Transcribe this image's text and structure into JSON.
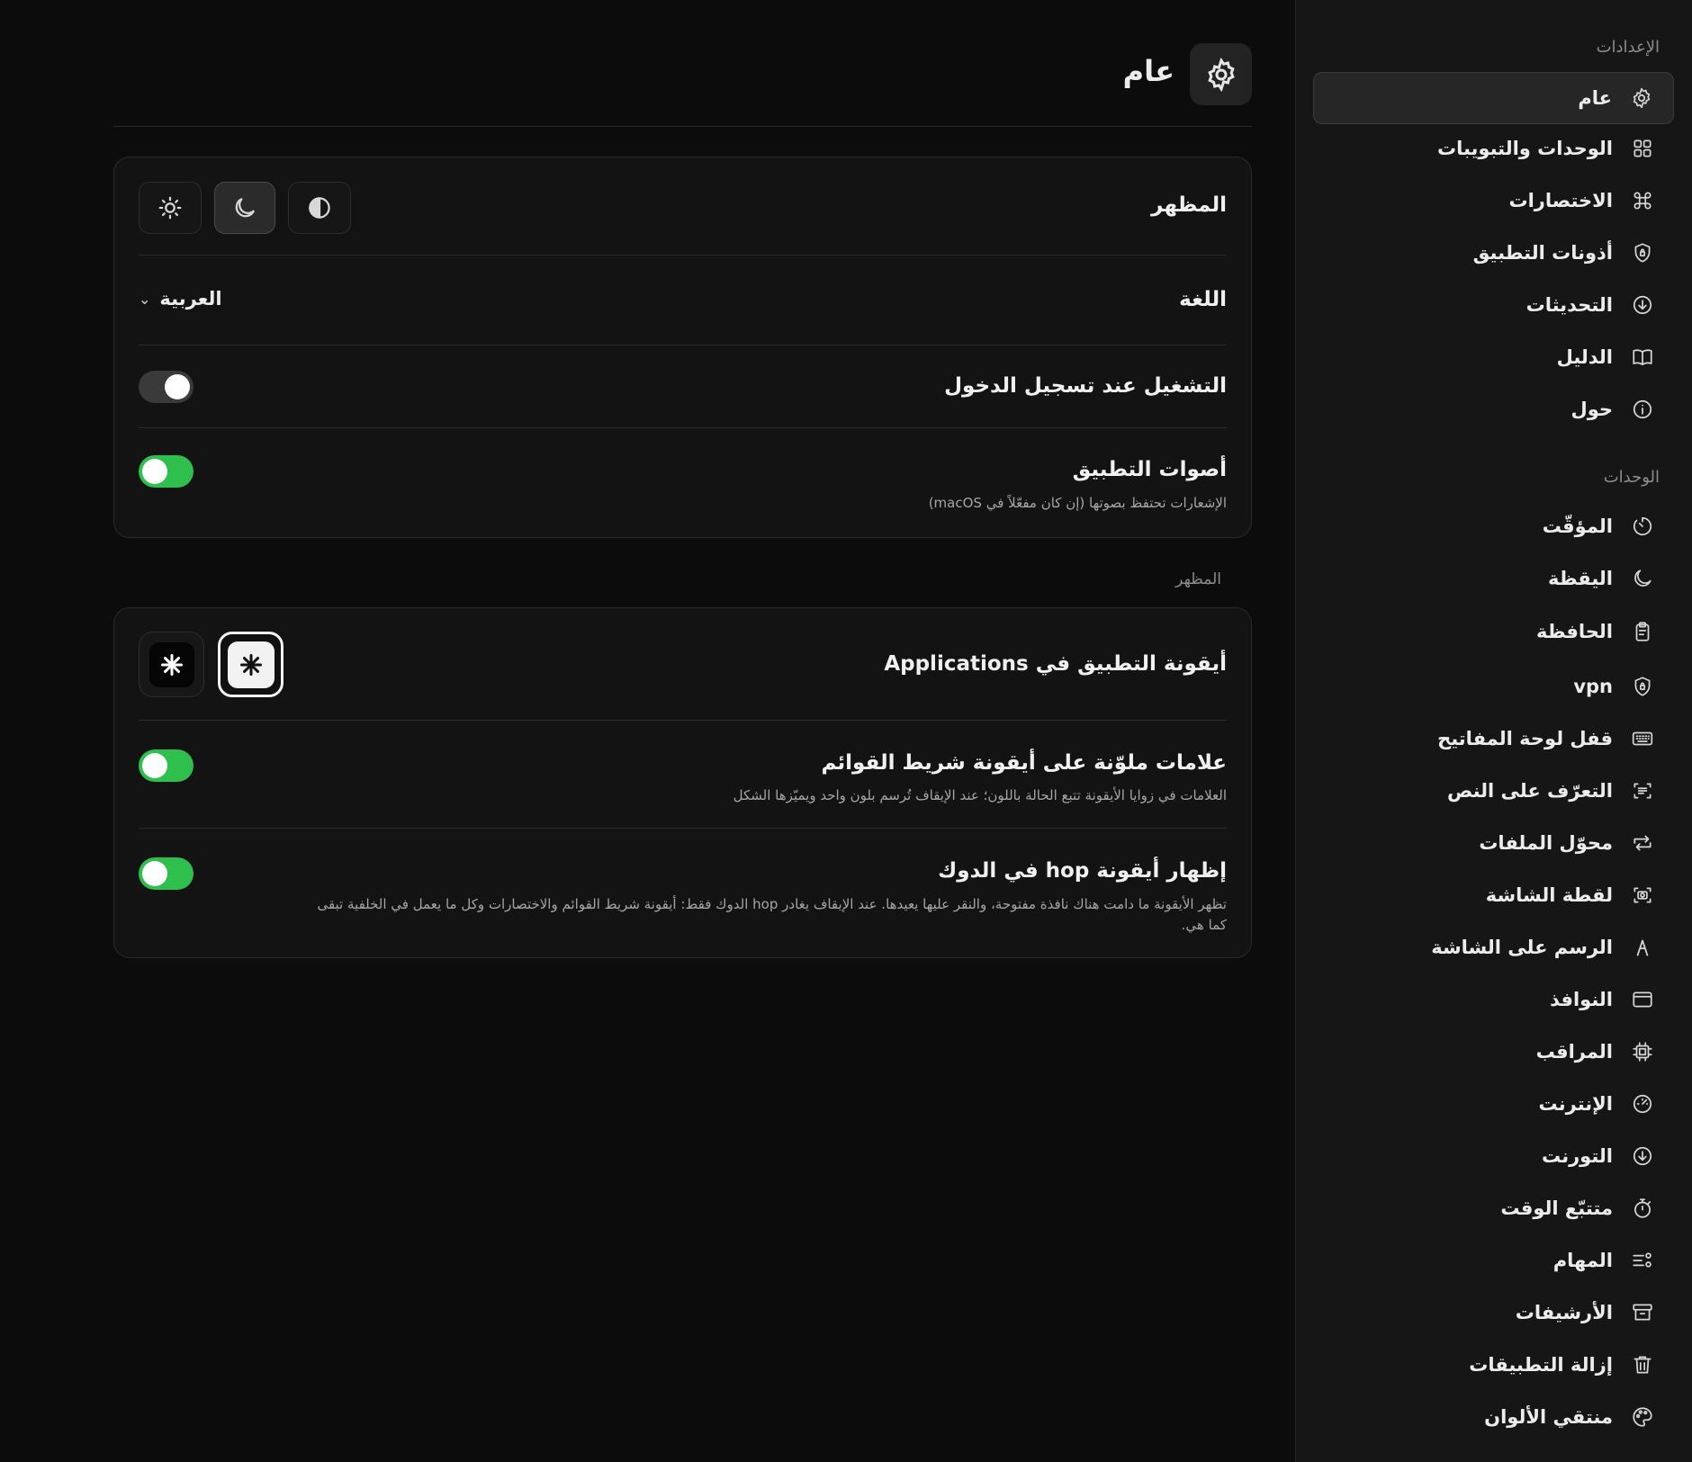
{
  "sidebar": {
    "settings_header": "الإعدادات",
    "settings_items": [
      {
        "label": "عام",
        "icon": "gear-icon",
        "active": true
      },
      {
        "label": "الوحدات والتبويبات",
        "icon": "grid-icon"
      },
      {
        "label": "الاختصارات",
        "icon": "command-icon"
      },
      {
        "label": "أذونات التطبيق",
        "icon": "shield-icon"
      },
      {
        "label": "التحديثات",
        "icon": "download-circle-icon"
      },
      {
        "label": "الدليل",
        "icon": "book-icon"
      },
      {
        "label": "حول",
        "icon": "info-icon"
      }
    ],
    "modules_header": "الوحدات",
    "module_items": [
      {
        "label": "المؤقّت",
        "icon": "timer-icon"
      },
      {
        "label": "اليقظة",
        "icon": "moon-icon"
      },
      {
        "label": "الحافظة",
        "icon": "clipboard-icon"
      },
      {
        "label": "vpn",
        "icon": "shield-lock-icon"
      },
      {
        "label": "قفل لوحة المفاتيح",
        "icon": "keyboard-icon"
      },
      {
        "label": "التعرّف على النص",
        "icon": "text-scan-icon"
      },
      {
        "label": "محوّل الملفات",
        "icon": "convert-icon"
      },
      {
        "label": "لقطة الشاشة",
        "icon": "screenshot-icon"
      },
      {
        "label": "الرسم على الشاشة",
        "icon": "draw-icon"
      },
      {
        "label": "النوافذ",
        "icon": "window-icon"
      },
      {
        "label": "المراقب",
        "icon": "cpu-icon"
      },
      {
        "label": "الإنترنت",
        "icon": "speedometer-icon"
      },
      {
        "label": "التورنت",
        "icon": "torrent-download-icon"
      },
      {
        "label": "متتبّع الوقت",
        "icon": "stopwatch-icon"
      },
      {
        "label": "المهام",
        "icon": "tasks-icon"
      },
      {
        "label": "الأرشيفات",
        "icon": "archive-icon"
      },
      {
        "label": "إزالة التطبيقات",
        "icon": "trash-icon"
      },
      {
        "label": "منتقي الألوان",
        "icon": "palette-icon"
      }
    ]
  },
  "header": {
    "title": "عام",
    "icon": "gear-icon"
  },
  "general_card": {
    "appearance_label": "المظهر",
    "appearance_options": [
      "sun-icon",
      "moon-icon",
      "contrast-icon"
    ],
    "appearance_selected": "moon-icon",
    "language_label": "اللغة",
    "language_value": "العربية",
    "launch_label": "التشغيل عند تسجيل الدخول",
    "launch_on": false,
    "sounds_label": "أصوات التطبيق",
    "sounds_desc": "الإشعارات تحتفظ بصوتها (إن كان مفعّلاً في macOS)",
    "sounds_on": true
  },
  "appearance_section": {
    "label": "المظهر",
    "app_icon_label": "أيقونة التطبيق في Applications",
    "icon_options": [
      "dark-app-icon",
      "light-app-icon"
    ],
    "icon_selected": "light-app-icon",
    "badges_label": "علامات ملوّنة على أيقونة شريط القوائم",
    "badges_desc": "العلامات في زوايا الأيقونة تتبع الحالة باللون؛ عند الإيقاف تُرسم بلون واحد ويميّزها الشكل",
    "badges_on": true,
    "dock_label": "إظهار أيقونة hop في الدوك",
    "dock_desc_1": "تظهر الأيقونة ما دامت هناك نافذة مفتوحة، والنقر عليها يعيدها. عند الإيقاف يغادر hop الدوك فقط: أيقونة شريط القوائم والاختصارات وكل ما يعمل في الخلفية تبقى",
    "dock_desc_2": "كما هي.",
    "dock_on": true
  },
  "colors": {
    "toggle_on": "#2fbf4c",
    "toggle_off": "#3a3a3a",
    "background": "#0c0c0c",
    "sidebar": "#161616"
  }
}
